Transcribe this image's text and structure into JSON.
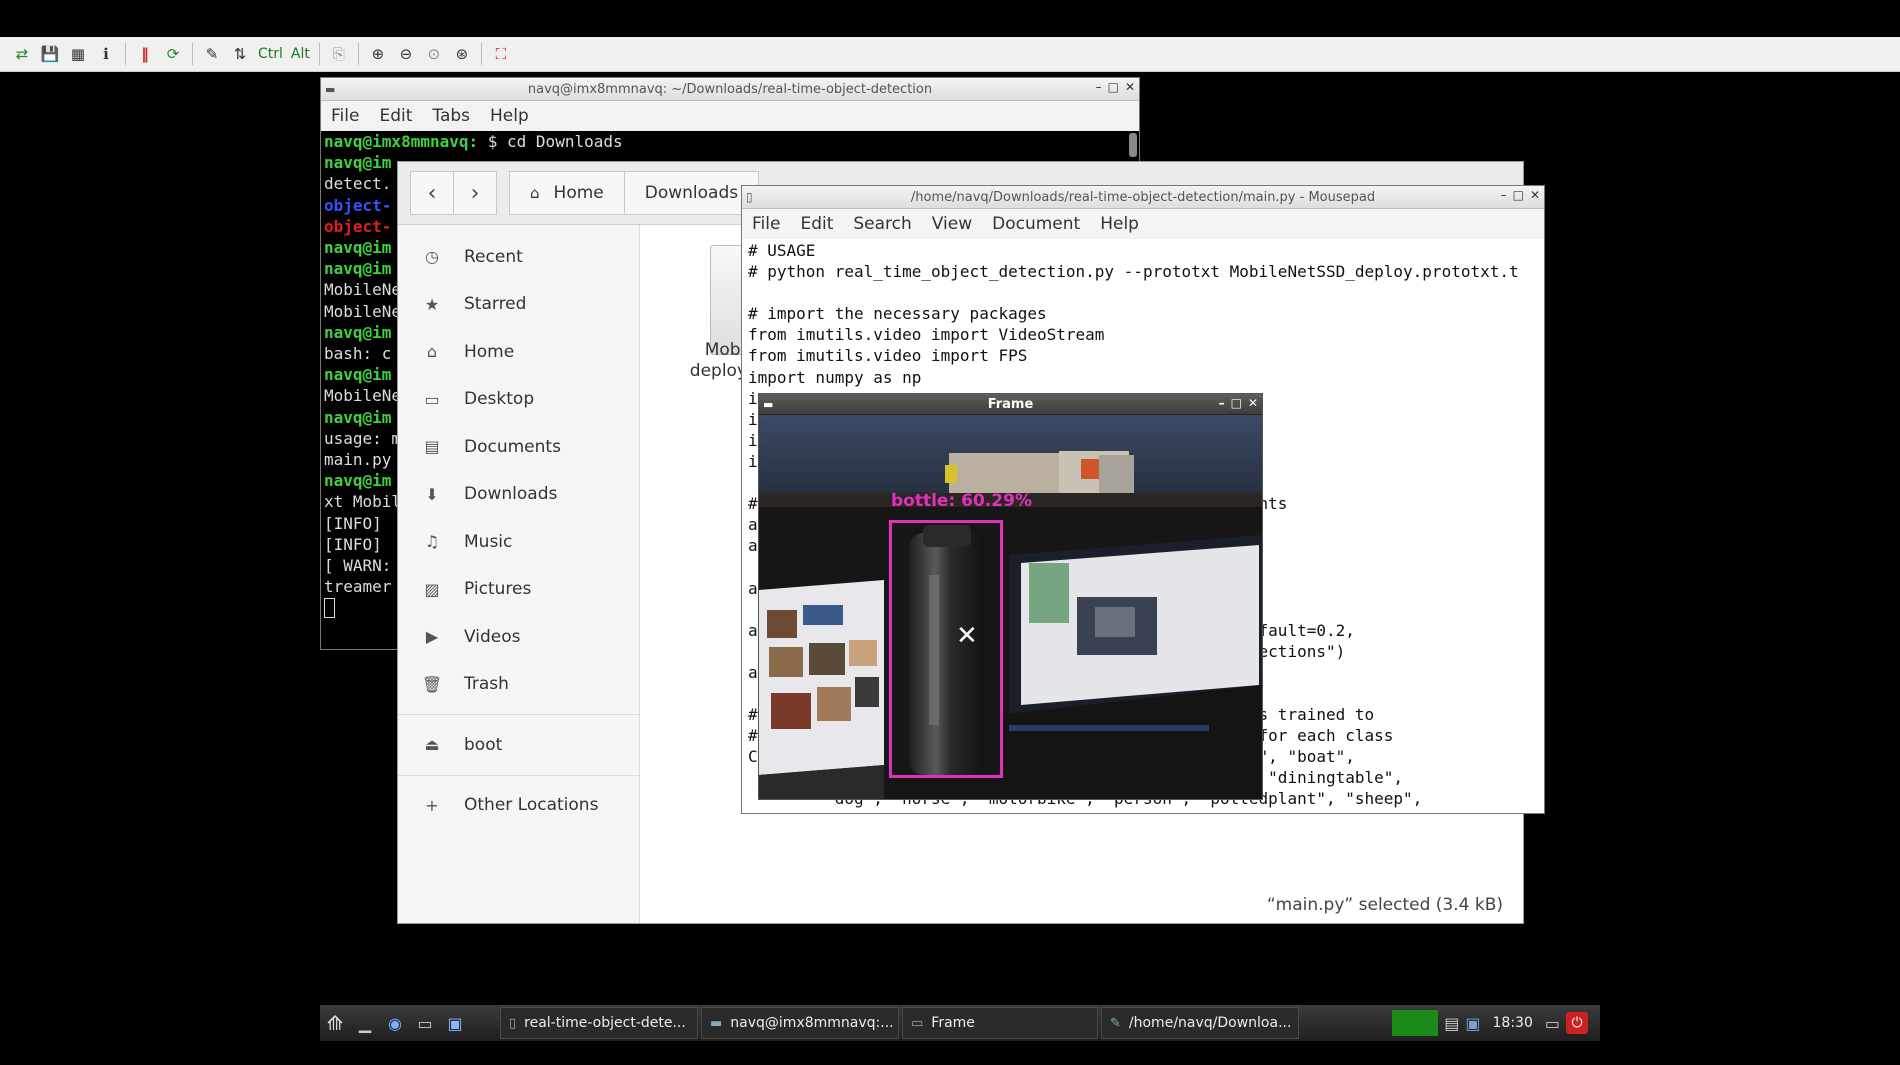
{
  "toolbar": {
    "ctrl": "Ctrl",
    "alt": "Alt"
  },
  "terminal": {
    "title": "navq@imx8mmnavq: ~/Downloads/real-time-object-detection",
    "menu": [
      "File",
      "Edit",
      "Tabs",
      "Help"
    ],
    "lines": [
      {
        "prompt": "navq@imx8mmnavq:",
        "text": " $ cd Downloads"
      },
      {
        "prompt": "navq@im",
        "text": ""
      },
      {
        "prompt": "",
        "text": "detect."
      },
      {
        "prompt": "",
        "text": "object-",
        "color": "blue"
      },
      {
        "prompt": "",
        "text": "object-",
        "color": "red"
      },
      {
        "prompt": "navq@im",
        "text": ""
      },
      {
        "prompt": "navq@im",
        "text": ""
      },
      {
        "prompt": "",
        "text": "MobileNe"
      },
      {
        "prompt": "",
        "text": "MobileNe"
      },
      {
        "prompt": "navq@im",
        "text": ""
      },
      {
        "prompt": "",
        "text": "bash: c"
      },
      {
        "prompt": "navq@im",
        "text": ""
      },
      {
        "prompt": "",
        "text": "MobileNe"
      },
      {
        "prompt": "navq@im",
        "text": ""
      },
      {
        "prompt": "",
        "text": "usage: m"
      },
      {
        "prompt": "",
        "text": "main.py"
      },
      {
        "prompt": "navq@im",
        "text": ""
      },
      {
        "prompt": "",
        "text": "xt Mobil"
      },
      {
        "prompt": "",
        "text": "[INFO]"
      },
      {
        "prompt": "",
        "text": "[INFO]"
      },
      {
        "prompt": "",
        "text": "[ WARN:"
      },
      {
        "prompt": "",
        "text": "treamer"
      }
    ]
  },
  "files": {
    "back": "‹",
    "forward": "›",
    "breadcrumb": [
      "Home",
      "Downloads"
    ],
    "sidebar": [
      {
        "label": "Recent",
        "icon": "clock-icon"
      },
      {
        "label": "Starred",
        "icon": "star-icon"
      },
      {
        "label": "Home",
        "icon": "home-icon"
      },
      {
        "label": "Desktop",
        "icon": "desktop-icon"
      },
      {
        "label": "Documents",
        "icon": "documents-icon"
      },
      {
        "label": "Downloads",
        "icon": "download-icon"
      },
      {
        "label": "Music",
        "icon": "music-icon"
      },
      {
        "label": "Pictures",
        "icon": "pictures-icon"
      },
      {
        "label": "Videos",
        "icon": "videos-icon"
      },
      {
        "label": "Trash",
        "icon": "trash-icon"
      }
    ],
    "devices": [
      {
        "label": "boot",
        "icon": "drive-icon"
      }
    ],
    "other": {
      "label": "Other Locations",
      "icon": "plus-icon"
    },
    "file_label_1": "Mobil",
    "file_label_2": "deploy.",
    "status": "“main.py” selected (3.4 kB)"
  },
  "mousepad": {
    "title": "/home/navq/Downloads/real-time-object-detection/main.py - Mousepad",
    "menu": [
      "File",
      "Edit",
      "Search",
      "View",
      "Document",
      "Help"
    ],
    "lines": [
      "# USAGE",
      "# python real_time_object_detection.py --prototxt MobileNetSSD_deploy.prototxt.t",
      "",
      "# import the necessary packages",
      "from imutils.video import VideoStream",
      "from imutils.video import FPS",
      "import numpy as np",
      "i",
      "i",
      "i",
      "i",
      "",
      "#                                                    nts",
      "a",
      "a",
      "",
      "a",
      "",
      "a                                                   efault=0.2,",
      "                                                    tections\")",
      "a",
      "",
      "#                                                  was trained to",
      "#                                                  s for each class",
      "C                                                  rd\", \"boat\",",
      "                                                   \", \"diningtable\",",
      "        \"dog\", \"horse\", \"motorbike\", \"person\", \"pottedplant\", \"sheep\","
    ]
  },
  "frame": {
    "title": "Frame",
    "detection_label": "bottle: 60.29%"
  },
  "taskbar": {
    "tasks": [
      {
        "label": "real-time-object-dete...",
        "icon": "document-icon"
      },
      {
        "label": "navq@imx8mmnavq:...",
        "icon": "terminal-icon"
      },
      {
        "label": "Frame",
        "icon": "window-icon"
      },
      {
        "label": "/home/navq/Downloa...",
        "icon": "text-editor-icon"
      }
    ],
    "clock": "18:30"
  }
}
